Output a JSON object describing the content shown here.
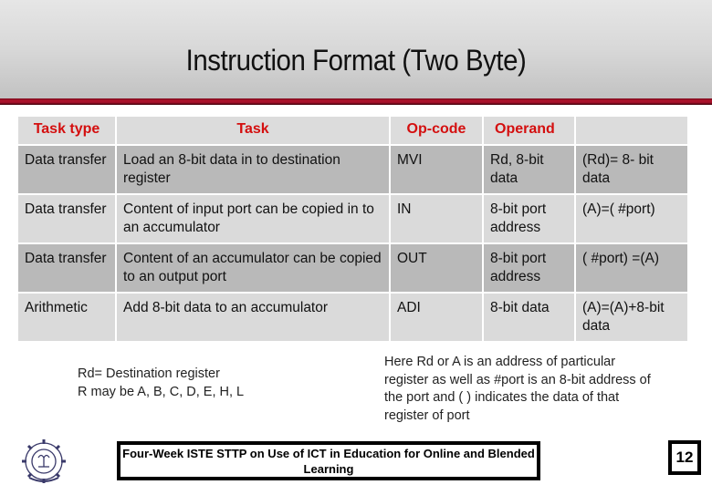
{
  "slide": {
    "title": "Instruction Format (Two Byte)",
    "accent_color": "#a0102a",
    "header_text_color": "#d40f0f"
  },
  "table": {
    "headers": [
      "Task type",
      "Task",
      "Op-code",
      "Operand",
      ""
    ],
    "rows": [
      {
        "task_type": "Data transfer",
        "task": "Load an 8-bit data in to destination register",
        "opcode": "MVI",
        "operand": "Rd, 8-bit data",
        "effect": "(Rd)= 8- bit data"
      },
      {
        "task_type": "Data transfer",
        "task": "Content of input port can be copied in to an accumulator",
        "opcode": "IN",
        "operand": "8-bit port address",
        "effect": "(A)=( #port)"
      },
      {
        "task_type": "Data transfer",
        "task": "Content of  an accumulator can be copied to an output port",
        "opcode": "OUT",
        "operand": "8-bit port address",
        "effect": "( #port) =(A)"
      },
      {
        "task_type": "Arithmetic",
        "task": "Add 8-bit data to an accumulator",
        "opcode": "ADI",
        "operand": "8-bit data",
        "effect": "(A)=(A)+8-bit data"
      }
    ]
  },
  "notes": {
    "left_line1": "Rd= Destination register",
    "left_line2": "R may be A, B, C, D, E, H, L",
    "right": "Here Rd or A  is an address of particular register as well as #port is an 8-bit address of the port and (  ) indicates the data of that register of port"
  },
  "footer": {
    "banner": "Four-Week ISTE STTP on Use of ICT in Education for Online and Blended Learning",
    "page_number": "12",
    "logo_icon": "institute-emblem-icon"
  }
}
